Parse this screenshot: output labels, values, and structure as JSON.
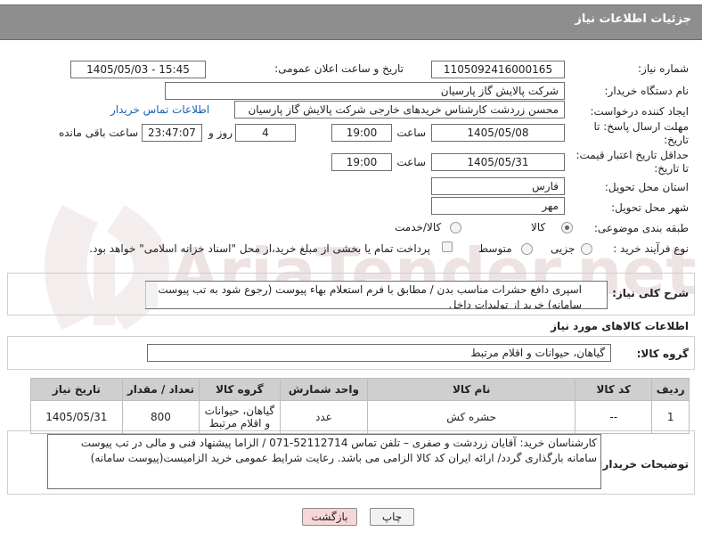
{
  "header": {
    "title": "جزئیات اطلاعات نیاز"
  },
  "fields": {
    "need_number_label": "شماره نیاز:",
    "need_number": "1105092416000165",
    "announce_label": "تاریخ و ساعت اعلان عمومی:",
    "announce_value": "1405/05/03 - 15:45",
    "buyer_org_label": "نام دستگاه خریدار:",
    "buyer_org": "شرکت پالایش گاز پارسیان",
    "creator_label": "ایجاد کننده درخواست:",
    "creator": "محسن زردشت کارشناس خریدهای خارجی شرکت پالایش گاز پارسیان",
    "contact_link": "اطلاعات تماس خریدار",
    "deadline_label": "مهلت ارسال پاسخ: تا تاریخ:",
    "deadline_date": "1405/05/08",
    "time_label": "ساعت",
    "deadline_time": "19:00",
    "days_value": "4",
    "days_label": "روز و",
    "remaining_value": "23:47:07",
    "remaining_label": "ساعت باقی مانده",
    "validity_label": "حداقل تاریخ اعتبار قیمت: تا تاریخ:",
    "validity_date": "1405/05/31",
    "validity_time_label": "ساعت",
    "validity_time": "19:00",
    "province_label": "استان محل تحویل:",
    "province": "فارس",
    "city_label": "شهر محل تحویل:",
    "city": "مهر",
    "category_label": "طبقه بندی موضوعی:",
    "category_goods": "کالا",
    "category_service": "کالا/خدمت",
    "process_label": "نوع فرآیند خرید :",
    "process_minor": "جزیی",
    "process_medium": "متوسط",
    "payment_note": "پرداخت تمام یا بخشی از مبلغ خرید،از محل \"اسناد خزانه اسلامی\" خواهد بود."
  },
  "description": {
    "label": "شرح کلی نیاز:",
    "text": "اسپری دافع حشرات مناسب بدن / مطابق با فرم استعلام بهاء پیوست (رجوع شود به تب پیوست سامانه) خرید از تولیدات داخل"
  },
  "goods_info": {
    "title": "اطلاعات کالاهای مورد نیاز",
    "group_label": "گروه کالا:",
    "group_value": "گیاهان، حیوانات و اقلام مرتبط"
  },
  "table": {
    "headers": [
      "ردیف",
      "کد کالا",
      "نام کالا",
      "واحد شمارش",
      "گروه کالا",
      "تعداد / مقدار",
      "تاریخ نیاز"
    ],
    "rows": [
      [
        "1",
        "--",
        "حشره کش",
        "عدد",
        "گیاهان، حیوانات و اقلام مرتبط",
        "800",
        "1405/05/31"
      ]
    ]
  },
  "buyer_notes": {
    "label": "توضیحات خریدار:",
    "text": "کارشناسان خرید: آقایان زردشت و صفری – تلفن تماس 52112714-071 / الزاما پیشنهاد فنی و مالی در تب پیوست سامانه بارگذاری گردد/ ارائه ایران کد کالا الزامی می باشد. رعایت شرایط عمومی خرید الزامیست(پیوست سامانه)"
  },
  "buttons": {
    "print": "چاپ",
    "back": "بازگشت"
  },
  "watermark": {
    "text": "AriaTender.net"
  },
  "colors": {
    "header": "#8e8e8e",
    "table_header": "#cfcfcf",
    "link": "#1a5fb4",
    "back_button": "#f6d6d6",
    "print_button": "#f2f2f2"
  }
}
